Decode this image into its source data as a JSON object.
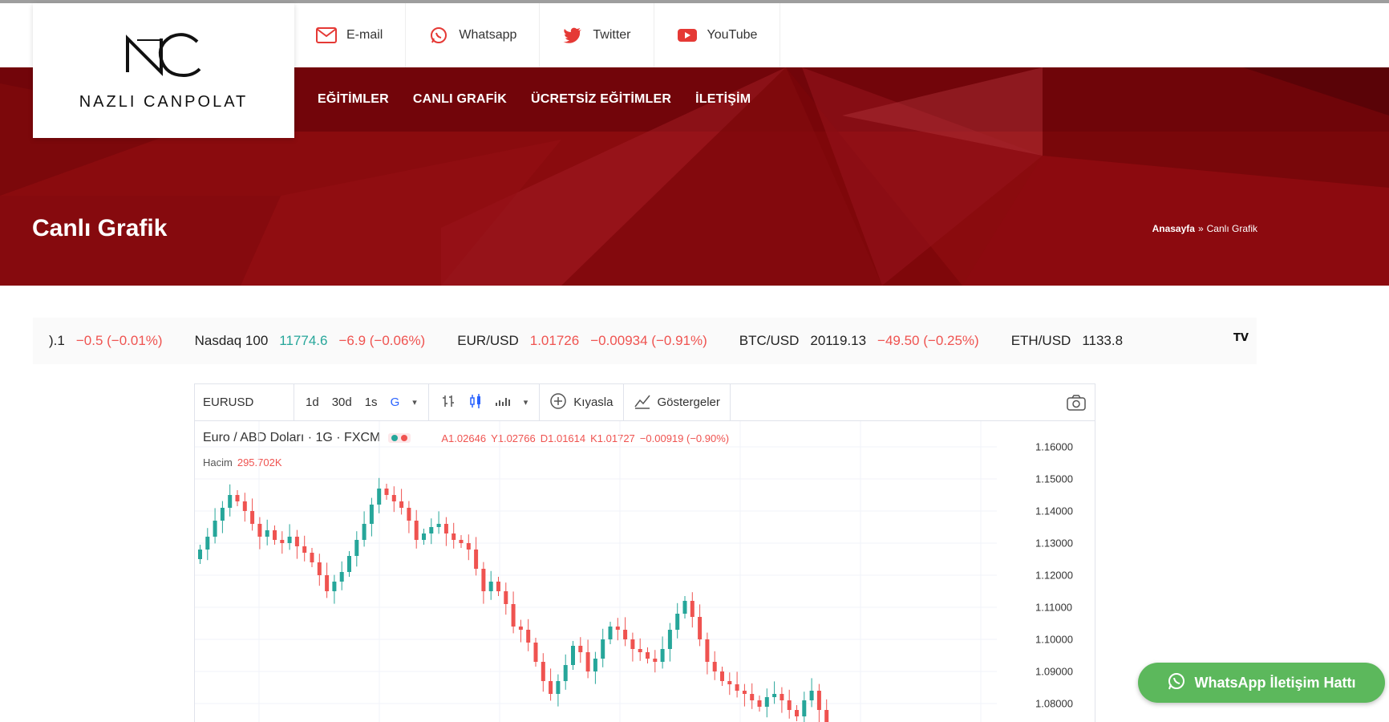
{
  "logo": {
    "text": "NAZLI CANPOLAT",
    "monogram": "NC"
  },
  "contacts": [
    {
      "label": "E-mail",
      "icon": "envelope-icon",
      "color": "#e53935"
    },
    {
      "label": "Whatsapp",
      "icon": "whatsapp-icon",
      "color": "#e53935"
    },
    {
      "label": "Twitter",
      "icon": "twitter-icon",
      "color": "#e53935"
    },
    {
      "label": "YouTube",
      "icon": "youtube-icon",
      "color": "#e53935"
    }
  ],
  "nav": [
    "EĞİTİMLER",
    "CANLI GRAFİK",
    "ÜCRETSİZ EĞİTİMLER",
    "İLETİŞİM"
  ],
  "hero": {
    "title": "Canlı Grafik",
    "breadcrumb_home": "Anasayfa",
    "breadcrumb_sep": "»",
    "breadcrumb_current": "Canlı Grafik",
    "bg_color": "#8a0b0e"
  },
  "ticker": [
    {
      "name": "",
      "price": ").1",
      "change": "−0.5 (−0.01%)",
      "price_up": false
    },
    {
      "name": "Nasdaq 100",
      "price": "11774.6",
      "change": "−6.9 (−0.06%)",
      "price_up": true
    },
    {
      "name": "EUR/USD",
      "price": "1.01726",
      "change": "−0.00934 (−0.91%)",
      "price_up": false
    },
    {
      "name": "BTC/USD",
      "price": "20119.13",
      "change": "−49.50 (−0.25%)",
      "price_up": false
    },
    {
      "name": "ETH/USD",
      "price": "1133.8",
      "change": "",
      "price_up": false
    }
  ],
  "ticker_logo": "TV",
  "chart": {
    "toolbar": {
      "symbol": "EURUSD",
      "ranges": [
        "1d",
        "30d",
        "1s"
      ],
      "active_range": "G",
      "compare": "Kıyasla",
      "indicators": "Göstergeler"
    },
    "legend": {
      "title": "Euro / ABD Doları · 1G · FXCM",
      "open": "A1.02646",
      "high": "Y1.02766",
      "low": "D1.01614",
      "close": "K1.01727",
      "change": "−0.00919 (−0.90%)"
    },
    "volume_label": "Hacim",
    "volume_value": "295.702K",
    "up_color": "#26a69a",
    "down_color": "#ef5350"
  },
  "chart_data": {
    "type": "candlestick",
    "title": "Euro / ABD Doları · 1G · FXCM",
    "yticks": [
      "1.16000",
      "1.15000",
      "1.14000",
      "1.13000",
      "1.12000",
      "1.11000",
      "1.10000",
      "1.09000",
      "1.08000"
    ],
    "ylim": [
      1.073,
      1.168
    ],
    "close": [
      1.128,
      1.132,
      1.137,
      1.141,
      1.145,
      1.143,
      1.14,
      1.136,
      1.132,
      1.134,
      1.131,
      1.13,
      1.132,
      1.129,
      1.127,
      1.124,
      1.12,
      1.115,
      1.118,
      1.121,
      1.126,
      1.131,
      1.136,
      1.142,
      1.147,
      1.145,
      1.143,
      1.141,
      1.137,
      1.131,
      1.133,
      1.135,
      1.136,
      1.133,
      1.131,
      1.13,
      1.128,
      1.122,
      1.115,
      1.118,
      1.115,
      1.111,
      1.104,
      1.103,
      1.099,
      1.093,
      1.087,
      1.083,
      1.087,
      1.092,
      1.098,
      1.096,
      1.09,
      1.094,
      1.1,
      1.104,
      1.103,
      1.1,
      1.097,
      1.096,
      1.094,
      1.093,
      1.097,
      1.103,
      1.108,
      1.112,
      1.107,
      1.1,
      1.093,
      1.09,
      1.087,
      1.086,
      1.084,
      1.083,
      1.081,
      1.079,
      1.082,
      1.083,
      1.081,
      1.078,
      1.076,
      1.081,
      1.084,
      1.078,
      1.072,
      1.068
    ]
  }
}
